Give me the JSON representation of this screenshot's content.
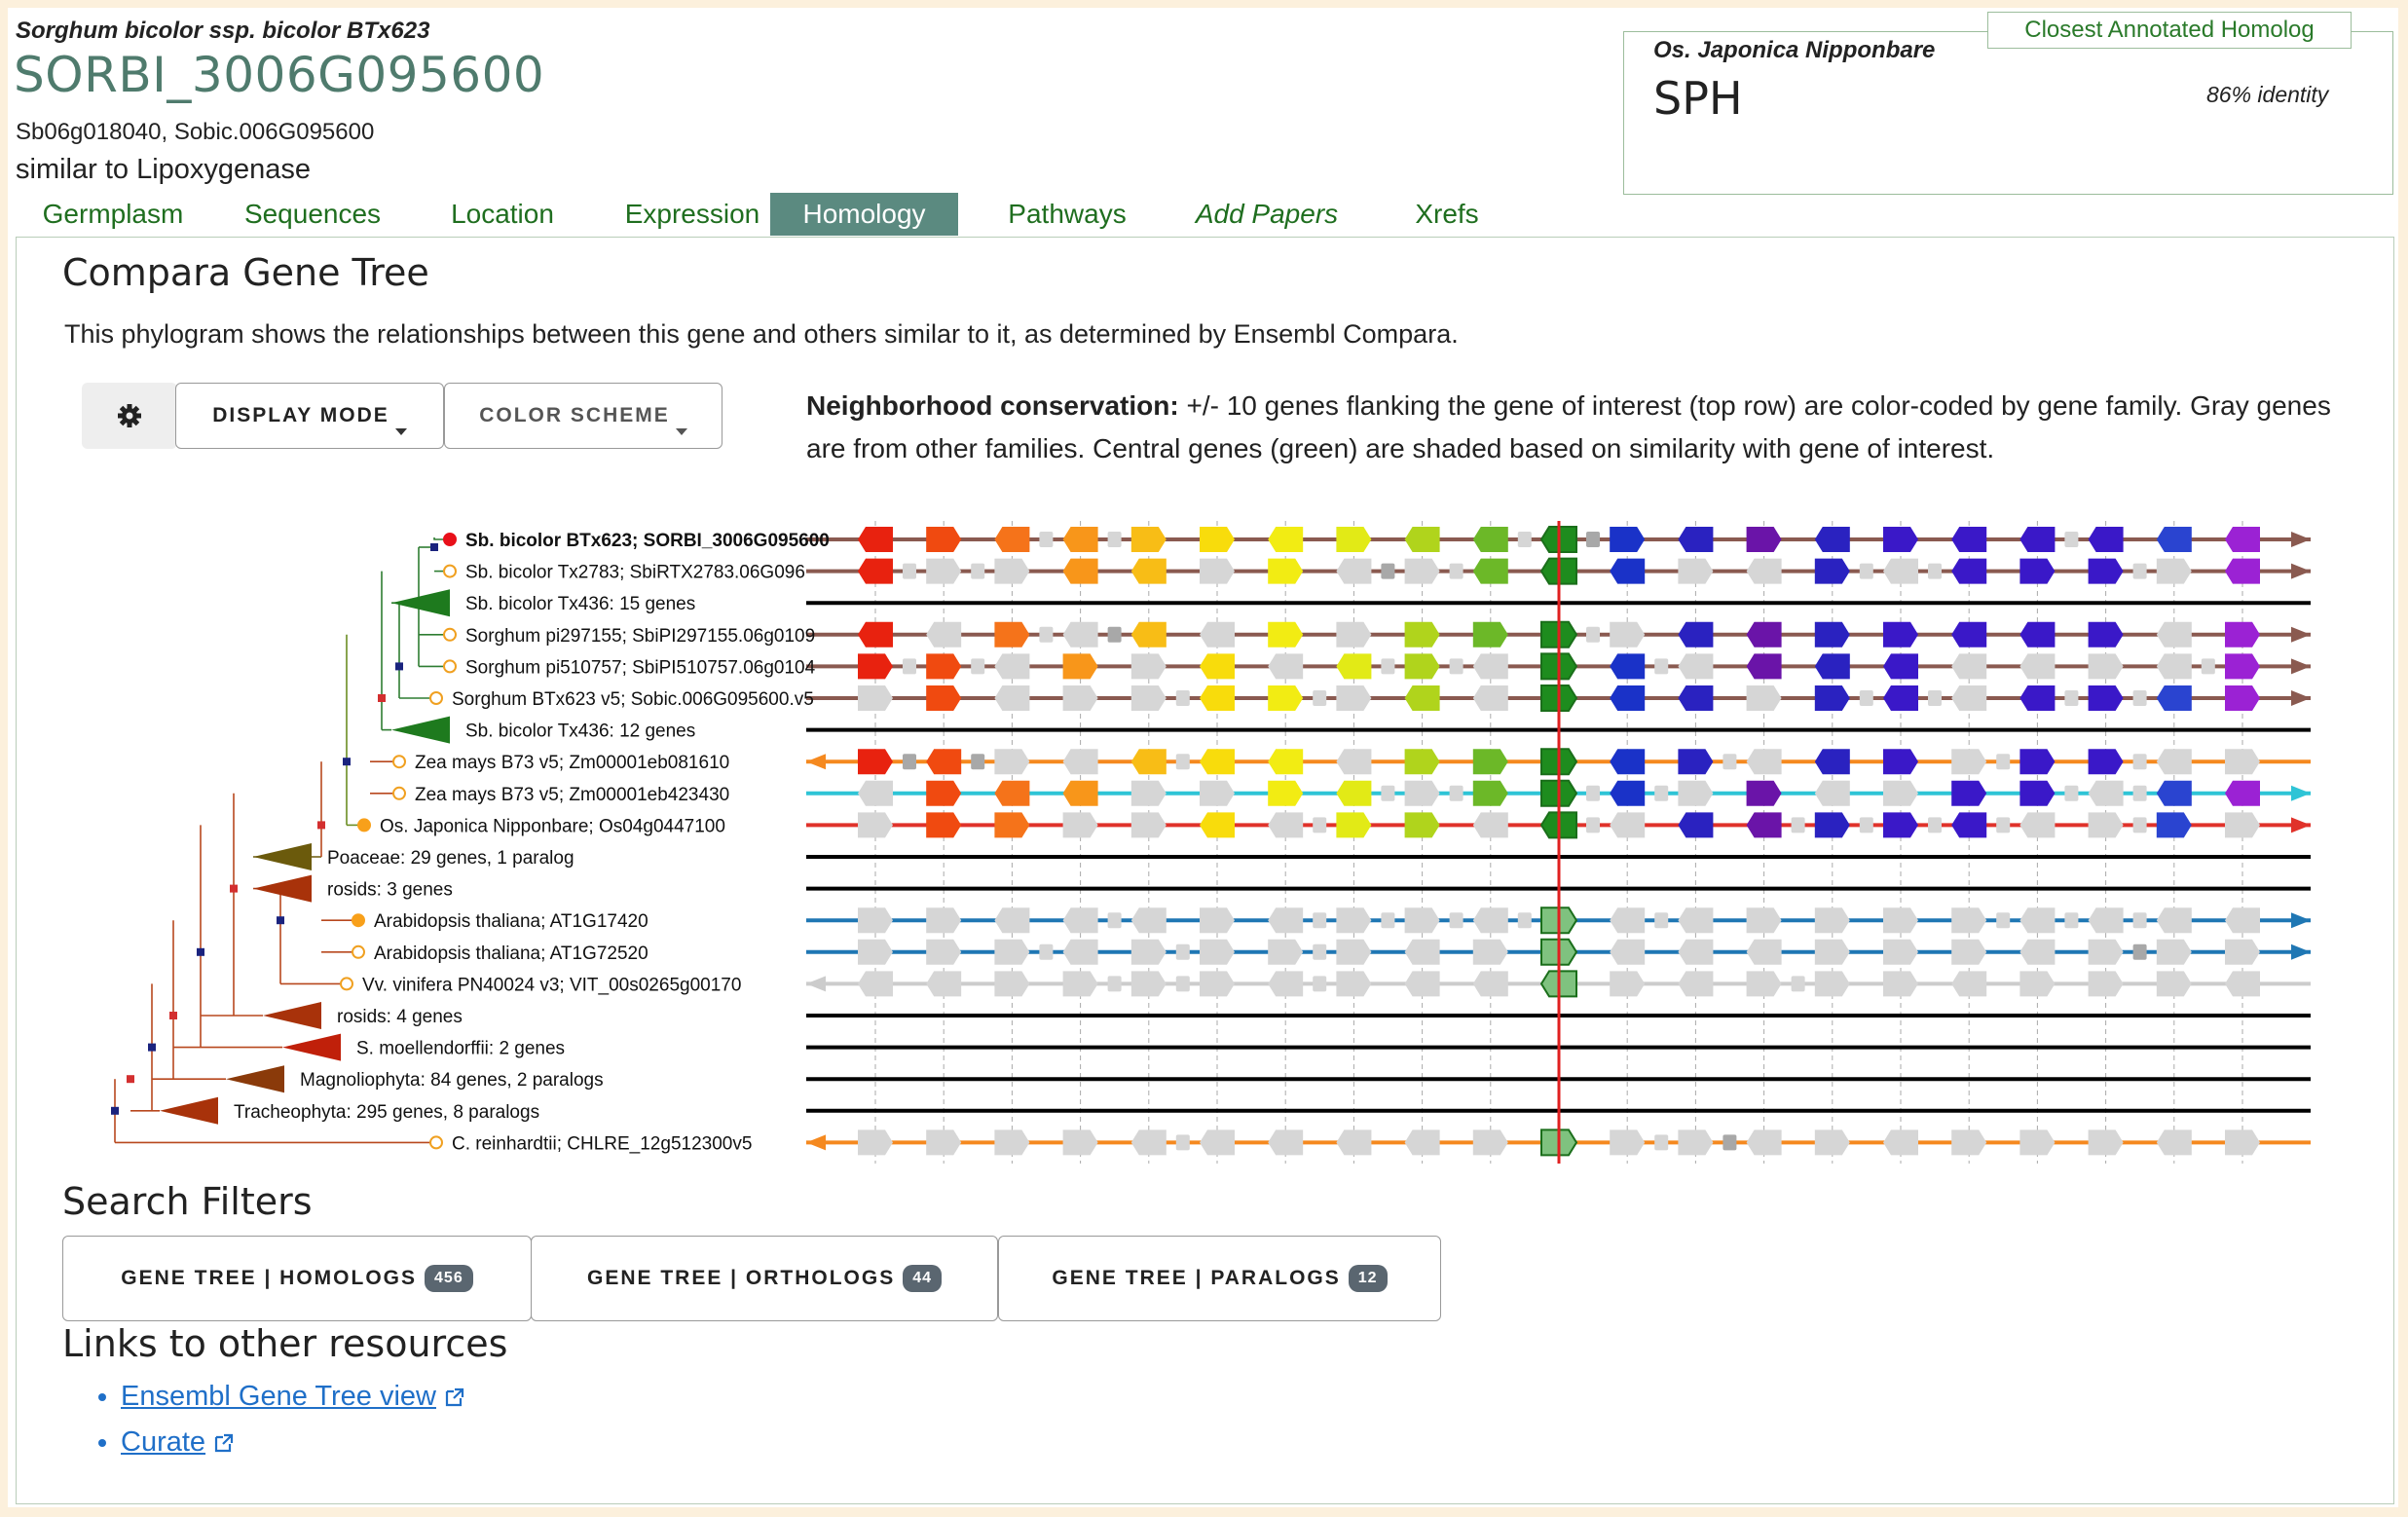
{
  "gene": {
    "species": "Sorghum bicolor ssp. bicolor BTx623",
    "id": "SORBI_3006G095600",
    "synonyms": "Sb06g018040, Sobic.006G095600",
    "description": "similar to Lipoxygenase"
  },
  "closest_homolog": {
    "tab_label": "Closest Annotated Homolog",
    "species": "Os. Japonica Nipponbare",
    "symbol": "SPH",
    "identity": "86% identity"
  },
  "tabs": [
    {
      "label": "Germplasm"
    },
    {
      "label": "Sequences"
    },
    {
      "label": "Location"
    },
    {
      "label": "Expression"
    },
    {
      "label": "Homology",
      "active": true
    },
    {
      "label": "Pathways"
    },
    {
      "label": "Add Papers"
    },
    {
      "label": "Xrefs"
    }
  ],
  "compara": {
    "title": "Compara Gene Tree",
    "intro": "This phylogram shows the relationships between this gene and others similar to it, as determined by Ensembl Compara.",
    "settings_icon": "gear-icon",
    "display_mode_label": "DISPLAY MODE",
    "color_scheme_label": "COLOR SCHEME",
    "neighborhood_bold": "Neighborhood conservation:",
    "neighborhood_text": "+/- 10 genes flanking the gene of interest (top row) are color-coded by gene family. Gray genes are from other families. Central genes (green) are shaded based on similarity with gene of interest."
  },
  "tree": {
    "leaves": [
      {
        "label": "Sb. bicolor BTx623; SORBI_3006G095600",
        "bold": true,
        "node": "filled-red",
        "line_color": "#8a5a50",
        "direction": "right"
      },
      {
        "label": "Sb. bicolor Tx2783; SbiRTX2783.06G096",
        "node": "open-orange",
        "line_color": "#8a5a50",
        "direction": "right"
      },
      {
        "label": "Sb. bicolor Tx436: 15 genes",
        "node": "triangle-green",
        "line_color": "#000000",
        "collapsed": true
      },
      {
        "label": "Sorghum pi297155; SbiPI297155.06g0109",
        "node": "open-orange",
        "line_color": "#8a5a50",
        "direction": "right"
      },
      {
        "label": "Sorghum pi510757; SbiPI510757.06g0104",
        "node": "open-orange",
        "line_color": "#8a5a50",
        "direction": "right"
      },
      {
        "label": "Sorghum BTx623 v5; Sobic.006G095600.v5",
        "node": "open-orange",
        "line_color": "#8a5a50",
        "direction": "right"
      },
      {
        "label": "Sb. bicolor Tx436: 12 genes",
        "node": "triangle-green",
        "line_color": "#000000",
        "collapsed": true
      },
      {
        "label": "Zea mays B73 v5; Zm00001eb081610",
        "node": "open-orange",
        "line_color": "#f5891f",
        "direction": "left"
      },
      {
        "label": "Zea mays B73 v5; Zm00001eb423430",
        "node": "open-orange",
        "line_color": "#2ec4d6",
        "direction": "right"
      },
      {
        "label": "Os. Japonica Nipponbare; Os04g0447100",
        "node": "filled-orange",
        "line_color": "#e0322a",
        "direction": "right"
      },
      {
        "label": "Poaceae: 29 genes, 1 paralog",
        "node": "triangle-olive",
        "line_color": "#000000",
        "collapsed": true
      },
      {
        "label": "rosids: 3 genes",
        "node": "triangle-rust",
        "line_color": "#000000",
        "collapsed": true
      },
      {
        "label": "Arabidopsis thaliana; AT1G17420",
        "node": "filled-orange",
        "line_color": "#1f77b4",
        "direction": "right"
      },
      {
        "label": "Arabidopsis thaliana; AT1G72520",
        "node": "open-orange",
        "line_color": "#1f77b4",
        "direction": "right"
      },
      {
        "label": "Vv. vinifera PN40024 v3; VIT_00s0265g00170",
        "node": "open-orange",
        "line_color": "#cccccc",
        "direction": "left"
      },
      {
        "label": "rosids: 4 genes",
        "node": "triangle-rust",
        "line_color": "#000000",
        "collapsed": true
      },
      {
        "label": "S. moellendorffii: 2 genes",
        "node": "triangle-red",
        "line_color": "#000000",
        "collapsed": true
      },
      {
        "label": "Magnoliophyta: 84 genes, 2 paralogs",
        "node": "triangle-brown",
        "line_color": "#000000",
        "collapsed": true
      },
      {
        "label": "Tracheophyta: 295 genes, 8 paralogs",
        "node": "triangle-rust",
        "line_color": "#000000",
        "collapsed": true
      },
      {
        "label": "C. reinhardtii; CHLRE_12g512300v5",
        "node": "open-orange",
        "line_color": "#f5891f",
        "direction": "left"
      }
    ],
    "gene_palette": [
      "#e8220f",
      "#f04a10",
      "#f5731a",
      "#f8961a",
      "#f8bd16",
      "#f8dc0c",
      "#f2ec13",
      "#e2ea16",
      "#b0d41c",
      "#6cb828",
      "#1e8c1e",
      "#1a32c8",
      "#2a22c0",
      "#6a14a8",
      "#2a22c0",
      "#3a18c8",
      "#3a18c8",
      "#3a18c8",
      "#3a18c8",
      "#2a44d0",
      "#9b22d4"
    ]
  },
  "search_filters": {
    "title": "Search Filters",
    "buttons": [
      {
        "label": "GENE TREE | HOMOLOGS",
        "count": "456"
      },
      {
        "label": "GENE TREE | ORTHOLOGS",
        "count": "44"
      },
      {
        "label": "GENE TREE | PARALOGS",
        "count": "12"
      }
    ]
  },
  "links": {
    "title": "Links to other resources",
    "items": [
      {
        "label": "Ensembl Gene Tree view",
        "icon": "external-link-icon"
      },
      {
        "label": "Curate",
        "icon": "external-link-icon"
      }
    ]
  }
}
